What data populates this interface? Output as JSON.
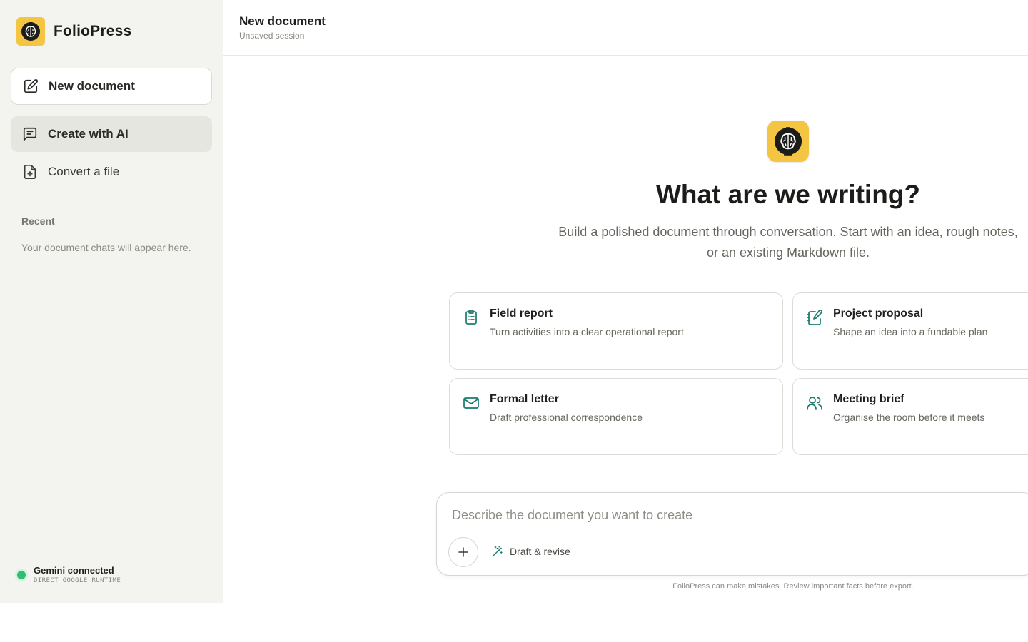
{
  "app": {
    "name": "FolioPress"
  },
  "sidebar": {
    "new_document": "New document",
    "create_with_ai": "Create with AI",
    "convert_file": "Convert a file",
    "recent_title": "Recent",
    "recent_empty": "Your document chats will appear here.",
    "status_title": "Gemini connected",
    "status_sub": "DIRECT GOOGLE RUNTIME"
  },
  "header": {
    "title": "New document",
    "subtitle": "Unsaved session"
  },
  "hero": {
    "title": "What are we writing?",
    "subtitle": "Build a polished document through conversation. Start with an idea, rough notes, or an existing Markdown file."
  },
  "cards": [
    {
      "title": "Field report",
      "desc": "Turn activities into a clear operational report",
      "icon": "clipboard-icon"
    },
    {
      "title": "Project proposal",
      "desc": "Shape an idea into a fundable plan",
      "icon": "notebook-pen-icon"
    },
    {
      "title": "Formal letter",
      "desc": "Draft professional correspondence",
      "icon": "mail-icon"
    },
    {
      "title": "Meeting brief",
      "desc": "Organise the room before it meets",
      "icon": "users-icon"
    }
  ],
  "composer": {
    "placeholder": "Describe the document you want to create",
    "mode_label": "Draft & revise"
  },
  "disclaimer": "FolioPress can make mistakes. Review important facts before export.",
  "colors": {
    "accent": "#1a7a6c",
    "brand_yellow": "#f4c542",
    "status_green": "#2fbf71"
  }
}
